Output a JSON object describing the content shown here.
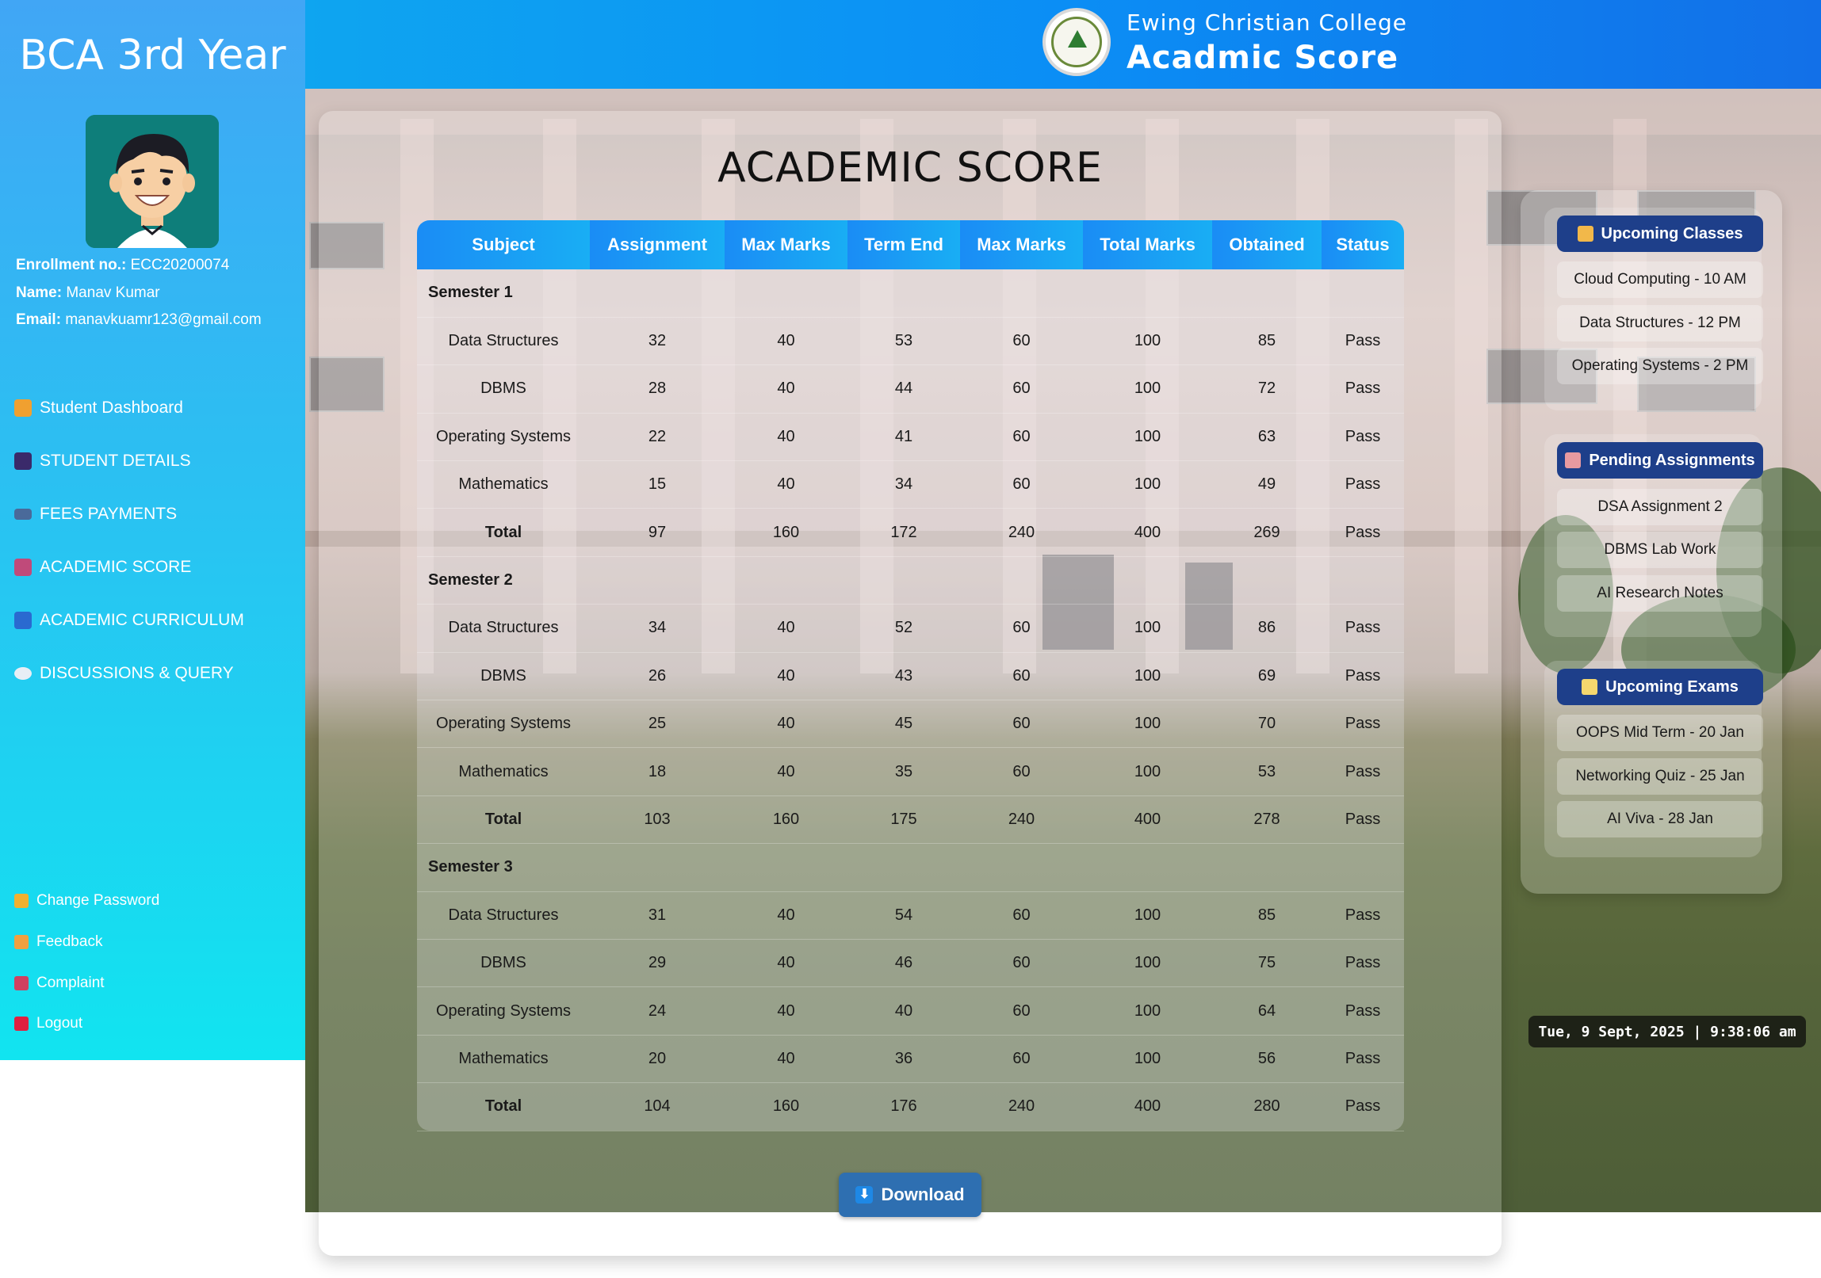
{
  "header": {
    "college_name": "Ewing Christian College",
    "page_heading": "Acadmic Score"
  },
  "sidebar": {
    "title": "BCA 3rd Year",
    "enrollment_label": "Enrollment no.:",
    "enrollment_value": "ECC20200074",
    "name_label": "Name:",
    "name_value": "Manav Kumar",
    "email_label": "Email:",
    "email_value": "manavkuamr123@gmail.com",
    "nav": [
      {
        "label": "Student Dashboard",
        "icon": "house-icon"
      },
      {
        "label": "STUDENT DETAILS",
        "icon": "student-icon"
      },
      {
        "label": "FEES PAYMENTS",
        "icon": "card-icon"
      },
      {
        "label": "ACADEMIC SCORE",
        "icon": "chart-icon"
      },
      {
        "label": "ACADEMIC CURRICULUM",
        "icon": "book-icon"
      },
      {
        "label": "DISCUSSIONS & QUERY",
        "icon": "speech-bubble-icon"
      }
    ],
    "footer": [
      {
        "label": "Change Password",
        "icon": "key-icon"
      },
      {
        "label": "Feedback",
        "icon": "hand-icon"
      },
      {
        "label": "Complaint",
        "icon": "mailbox-icon"
      },
      {
        "label": "Logout",
        "icon": "logout-icon"
      }
    ]
  },
  "main": {
    "title": "ACADEMIC SCORE",
    "columns": [
      "Subject",
      "Assignment",
      "Max Marks",
      "Term End",
      "Max Marks",
      "Total Marks",
      "Obtained",
      "Status"
    ],
    "semesters": [
      {
        "name": "Semester 1",
        "rows": [
          [
            "Data Structures",
            "32",
            "40",
            "53",
            "60",
            "100",
            "85",
            "Pass"
          ],
          [
            "DBMS",
            "28",
            "40",
            "44",
            "60",
            "100",
            "72",
            "Pass"
          ],
          [
            "Operating Systems",
            "22",
            "40",
            "41",
            "60",
            "100",
            "63",
            "Pass"
          ],
          [
            "Mathematics",
            "15",
            "40",
            "34",
            "60",
            "100",
            "49",
            "Pass"
          ],
          [
            "Total",
            "97",
            "160",
            "172",
            "240",
            "400",
            "269",
            "Pass"
          ]
        ]
      },
      {
        "name": "Semester 2",
        "rows": [
          [
            "Data Structures",
            "34",
            "40",
            "52",
            "60",
            "100",
            "86",
            "Pass"
          ],
          [
            "DBMS",
            "26",
            "40",
            "43",
            "60",
            "100",
            "69",
            "Pass"
          ],
          [
            "Operating Systems",
            "25",
            "40",
            "45",
            "60",
            "100",
            "70",
            "Pass"
          ],
          [
            "Mathematics",
            "18",
            "40",
            "35",
            "60",
            "100",
            "53",
            "Pass"
          ],
          [
            "Total",
            "103",
            "160",
            "175",
            "240",
            "400",
            "278",
            "Pass"
          ]
        ]
      },
      {
        "name": "Semester 3",
        "rows": [
          [
            "Data Structures",
            "31",
            "40",
            "54",
            "60",
            "100",
            "85",
            "Pass"
          ],
          [
            "DBMS",
            "29",
            "40",
            "46",
            "60",
            "100",
            "75",
            "Pass"
          ],
          [
            "Operating Systems",
            "24",
            "40",
            "40",
            "60",
            "100",
            "64",
            "Pass"
          ],
          [
            "Mathematics",
            "20",
            "40",
            "36",
            "60",
            "100",
            "56",
            "Pass"
          ],
          [
            "Total",
            "104",
            "160",
            "176",
            "240",
            "400",
            "280",
            "Pass"
          ]
        ]
      }
    ],
    "download_label": "Download"
  },
  "right_panel": {
    "upcoming_classes": {
      "title": "Upcoming Classes",
      "items": [
        "Cloud Computing - 10 AM",
        "Data Structures - 12 PM",
        "Operating Systems - 2 PM"
      ]
    },
    "pending_assignments": {
      "title": "Pending Assignments",
      "items": [
        "DSA Assignment 2",
        "DBMS Lab Work",
        "AI Research Notes"
      ]
    },
    "upcoming_exams": {
      "title": "Upcoming Exams",
      "items": [
        "OOPS Mid Term - 20 Jan",
        "Networking Quiz - 25 Jan",
        "AI Viva - 28 Jan"
      ]
    }
  },
  "clock": "Tue, 9 Sept, 2025 | 9:38:06 am",
  "colors": {
    "header_gradient_start": "#0ea5f0",
    "header_gradient_end": "#1270e8",
    "sidebar_top": "#41a6f5",
    "sidebar_bottom": "#11e4f0",
    "table_header": "#1a8cf5",
    "card_header": "#1e3f8a",
    "download_button": "#2e6fb1"
  }
}
